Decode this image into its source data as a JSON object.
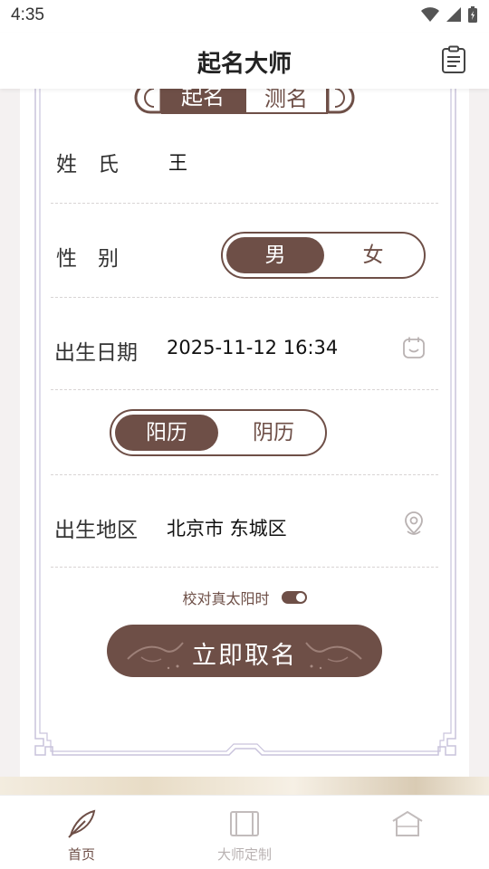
{
  "status_bar": {
    "time": "4:35"
  },
  "app_bar": {
    "title": "起名大师",
    "clipboard_icon": "clipboard-icon"
  },
  "mode_toggle": {
    "options": [
      "起名",
      "测名"
    ],
    "selected": "起名"
  },
  "form": {
    "surname": {
      "label": "姓　氏",
      "value": "王"
    },
    "gender": {
      "label": "性　别",
      "options": [
        "男",
        "女"
      ],
      "selected": "男"
    },
    "birth_date": {
      "label": "出生日期",
      "value": "2025-11-12 16:34",
      "icon": "calendar-icon"
    },
    "calendar_type": {
      "options": [
        "阳历",
        "阴历"
      ],
      "selected": "阳历"
    },
    "birth_region": {
      "label": "出生地区",
      "value": "北京市 东城区",
      "icon": "location-pin-icon"
    },
    "true_solar_time": {
      "label": "校对真太阳时",
      "enabled": true
    }
  },
  "cta": {
    "label": "立即取名"
  },
  "tabbar": {
    "items": [
      {
        "label": "首页",
        "icon": "feather-icon",
        "active": true
      },
      {
        "label": "大师定制",
        "icon": "scroll-icon",
        "active": false
      },
      {
        "label": "",
        "icon": "house-icon",
        "active": false
      }
    ]
  },
  "colors": {
    "accent": "#6e4f47",
    "divider": "#d8d4d4",
    "background": "#f4f1f1"
  }
}
